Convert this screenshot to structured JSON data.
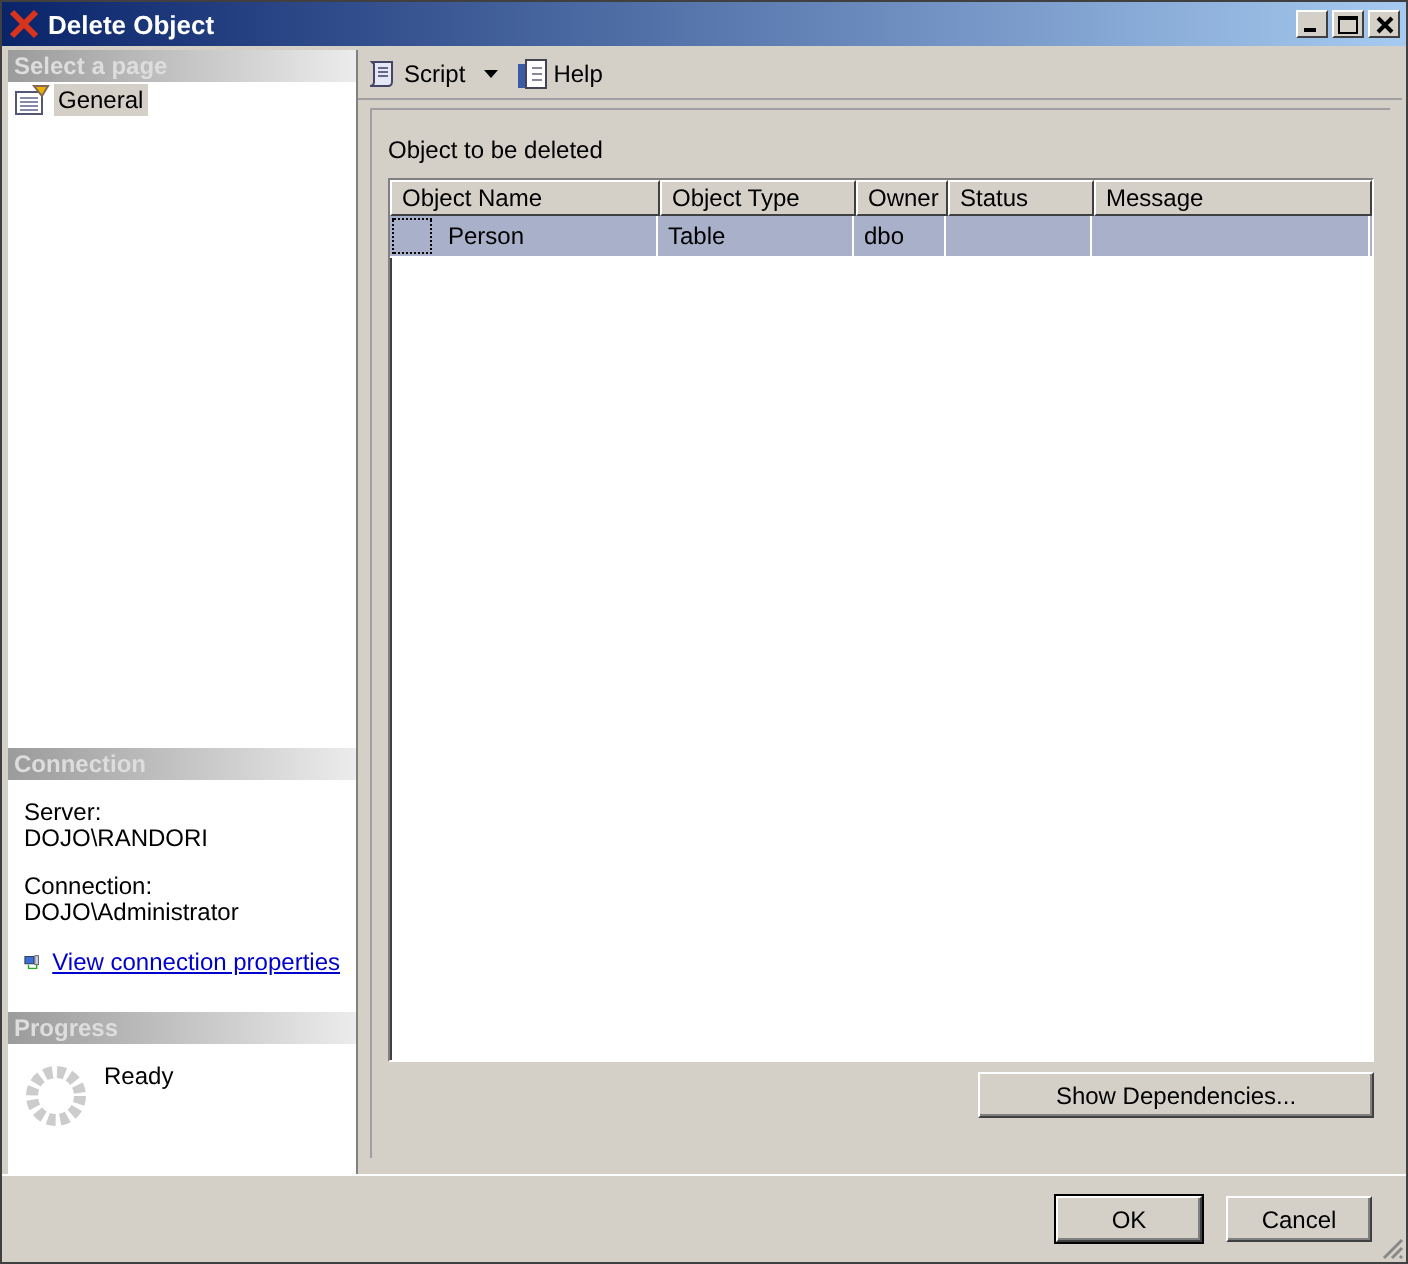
{
  "window": {
    "title": "Delete Object"
  },
  "sidebar": {
    "header": "Select a page",
    "pages": [
      {
        "label": "General",
        "selected": true
      }
    ]
  },
  "connection": {
    "header": "Connection",
    "server_label": "Server:",
    "server": "DOJO\\RANDORI",
    "connection_label": "Connection:",
    "connection": "DOJO\\Administrator",
    "link": "View connection properties"
  },
  "progress": {
    "header": "Progress",
    "status": "Ready"
  },
  "toolbar": {
    "script": "Script",
    "help": "Help"
  },
  "grid": {
    "label": "Object to be deleted",
    "columns": [
      "Object Name",
      "Object Type",
      "Owner",
      "Status",
      "Message"
    ],
    "rows": [
      {
        "cells": [
          "Person",
          "Table",
          "dbo",
          "",
          ""
        ],
        "selected": true
      }
    ]
  },
  "show_dependencies": "Show Dependencies...",
  "buttons": [
    "OK",
    "Cancel"
  ]
}
